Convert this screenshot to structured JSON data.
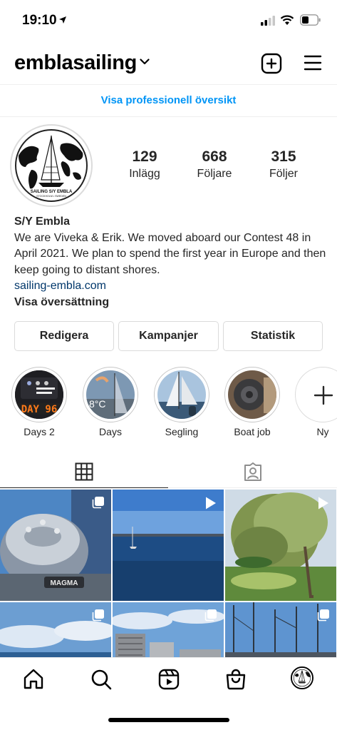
{
  "status_bar": {
    "time": "19:10"
  },
  "header": {
    "username": "emblasailing"
  },
  "pro_banner": {
    "label": "Visa professionell översikt"
  },
  "avatar": {
    "text": "SAILING S/Y EMBLA",
    "subtext": "STOCKHOLM • SWEDEN"
  },
  "stats": [
    {
      "value": "129",
      "label": "Inlägg"
    },
    {
      "value": "668",
      "label": "Följare"
    },
    {
      "value": "315",
      "label": "Följer"
    }
  ],
  "bio": {
    "name": "S/Y Embla",
    "text": "We are Viveka & Erik. We moved aboard our Contest 48 in April 2021. We plan to spend the first year in Europe and then keep going to distant shores.",
    "link": "sailing-embla.com",
    "translate": "Visa översättning"
  },
  "buttons": {
    "edit": "Redigera",
    "campaigns": "Kampanjer",
    "stats": "Statistik"
  },
  "highlights": [
    {
      "label": "Days 2",
      "overlay": "DAY 96"
    },
    {
      "label": "Days",
      "overlay": "8°C"
    },
    {
      "label": "Segling"
    },
    {
      "label": "Boat job"
    },
    {
      "label": "Ny"
    }
  ],
  "grid_posts": [
    {
      "type": "carousel",
      "overlay": "MAGMA"
    },
    {
      "type": "video"
    },
    {
      "type": "video"
    },
    {
      "type": "carousel"
    },
    {
      "type": "carousel"
    },
    {
      "type": "carousel"
    }
  ],
  "colors": {
    "link_blue": "#0095f6",
    "bio_link": "#00376b",
    "text": "#262626",
    "border": "#dbdbdb"
  }
}
